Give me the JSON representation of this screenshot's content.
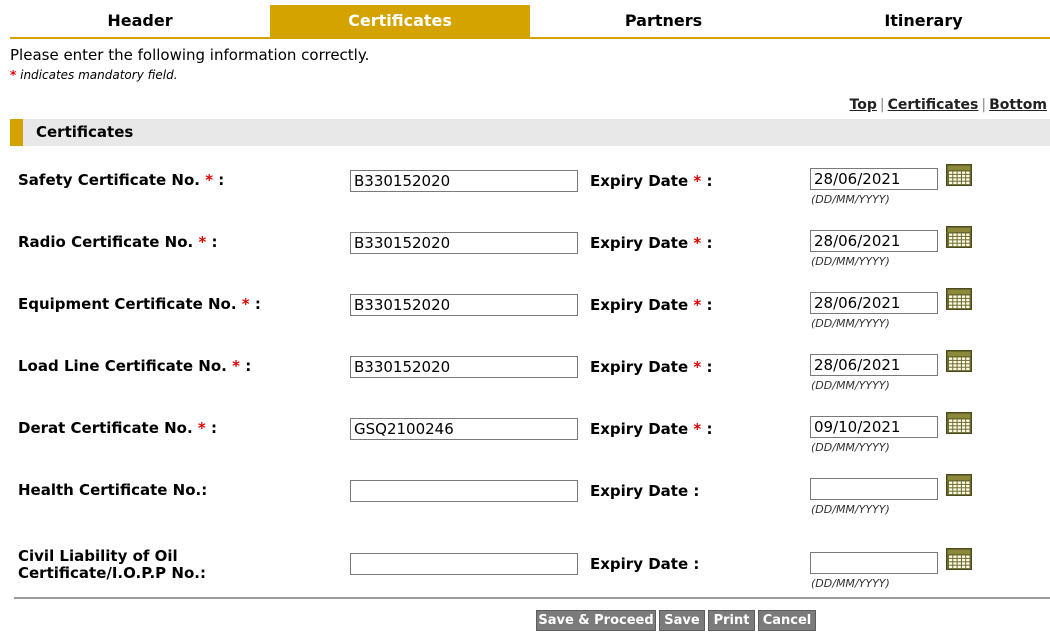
{
  "tabs": [
    "Header",
    "Certificates",
    "Partners",
    "Itinerary"
  ],
  "intro": "Please enter the following information correctly.",
  "mandatory_star": "*",
  "mandatory_note": "indicates mandatory field.",
  "links": {
    "top": "Top",
    "certificates": "Certificates",
    "bottom": "Bottom"
  },
  "section_title": "Certificates",
  "expiry_label": "Expiry Date",
  "date_format_hint": "(DD/MM/YYYY)",
  "rows": [
    {
      "label": "Safety Certificate No.",
      "label_line2": "",
      "required": "*",
      "value": "B330152020",
      "expiry_required": "*",
      "expiry": "28/06/2021"
    },
    {
      "label": "Radio Certificate No.",
      "label_line2": "",
      "required": "*",
      "value": "B330152020",
      "expiry_required": "*",
      "expiry": "28/06/2021"
    },
    {
      "label": "Equipment Certificate No.",
      "label_line2": "",
      "required": "*",
      "value": "B330152020",
      "expiry_required": "*",
      "expiry": "28/06/2021"
    },
    {
      "label": "Load Line Certificate No.",
      "label_line2": "",
      "required": "*",
      "value": "B330152020",
      "expiry_required": "*",
      "expiry": "28/06/2021"
    },
    {
      "label": "Derat Certificate No.",
      "label_line2": "",
      "required": "*",
      "value": "GSQ2100246",
      "expiry_required": "*",
      "expiry": "09/10/2021"
    },
    {
      "label": "Health Certificate No.:",
      "label_line2": "",
      "required": "",
      "value": "",
      "expiry_required": "",
      "expiry": ""
    },
    {
      "label": "Civil Liability of Oil",
      "label_line2": "Certificate/I.O.P.P No.:",
      "required": "",
      "value": "",
      "expiry_required": "",
      "expiry": ""
    }
  ],
  "buttons": {
    "save_proceed": "Save & Proceed",
    "save": "Save",
    "print": "Print",
    "cancel": "Cancel"
  },
  "colors": {
    "accent": "#d4a300",
    "button": "#7b7b7b",
    "required": "#e00000",
    "section_bg": "#e8e8e8"
  }
}
